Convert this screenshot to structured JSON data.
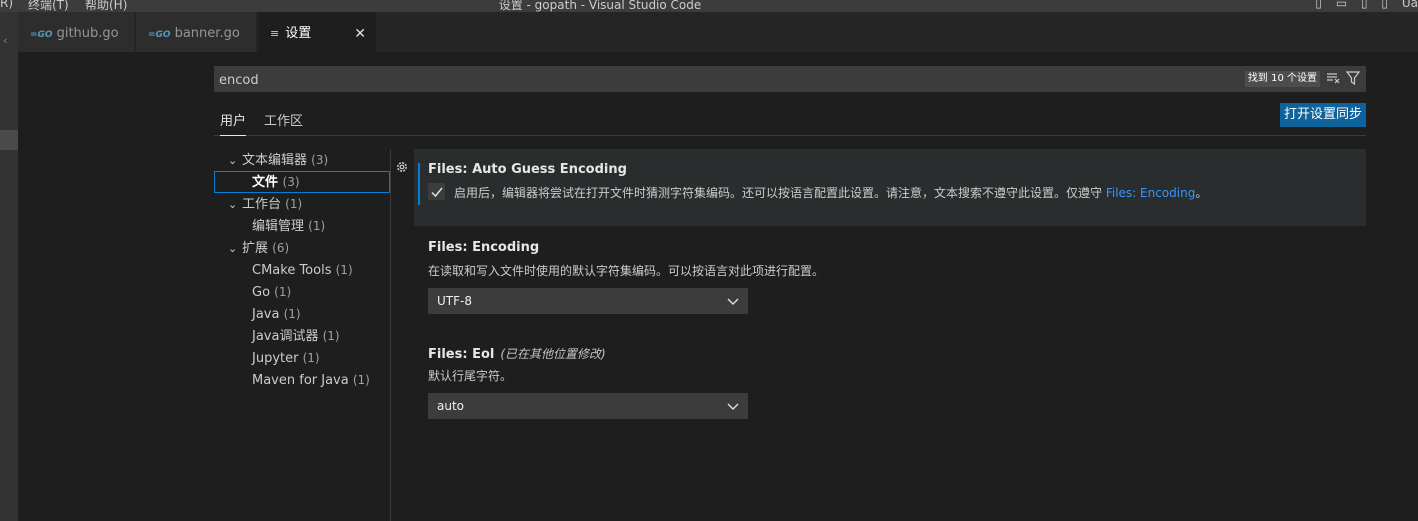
{
  "titlebar": {
    "menu_partial": "R)",
    "menu_terminal": "终端(T)",
    "menu_help": "帮助(H)",
    "window_title": "设置 - gopath - Visual Studio Code",
    "partial_right": "Ua"
  },
  "tabs": [
    {
      "label": "github.go",
      "icon": "go-file-icon"
    },
    {
      "label": "banner.go",
      "icon": "go-file-icon"
    },
    {
      "label": "设置",
      "icon": "settings-list-icon",
      "active": true
    }
  ],
  "search": {
    "value": "encod",
    "result_count": "找到 10 个设置"
  },
  "scopes": {
    "user": "用户",
    "workspace": "工作区",
    "sync_button": "打开设置同步"
  },
  "toc": [
    {
      "label": "文本编辑器",
      "count": "(3)",
      "expanded": true
    },
    {
      "label": "文件",
      "count": "(3)",
      "selected": true
    },
    {
      "label": "工作台",
      "count": "(1)",
      "expanded": true
    },
    {
      "label": "编辑管理",
      "count": "(1)"
    },
    {
      "label": "扩展",
      "count": "(6)",
      "expanded": true
    },
    {
      "label": "CMake Tools",
      "count": "(1)"
    },
    {
      "label": "Go",
      "count": "(1)"
    },
    {
      "label": "Java",
      "count": "(1)"
    },
    {
      "label": "Java调试器",
      "count": "(1)"
    },
    {
      "label": "Jupyter",
      "count": "(1)"
    },
    {
      "label": "Maven for Java",
      "count": "(1)"
    }
  ],
  "settings": {
    "auto_guess": {
      "category": "Files: ",
      "name": "Auto Guess Encoding",
      "description": "启用后，编辑器将尝试在打开文件时猜测字符集编码。还可以按语言配置此设置。请注意，文本搜索不遵守此设置。仅遵守 ",
      "link": "Files: Encoding",
      "desc_end": "。",
      "checked": true
    },
    "encoding": {
      "category": "Files: ",
      "name": "Encoding",
      "description": "在读取和写入文件时使用的默认字符集编码。可以按语言对此项进行配置。",
      "value": "UTF-8"
    },
    "eol": {
      "category": "Files: ",
      "name": "Eol",
      "modified": "(已在其他位置修改)",
      "description": "默认行尾字符。",
      "value": "auto"
    }
  },
  "colors": {
    "accent": "#007fd4",
    "button": "#0e639c",
    "link": "#3794ff"
  }
}
